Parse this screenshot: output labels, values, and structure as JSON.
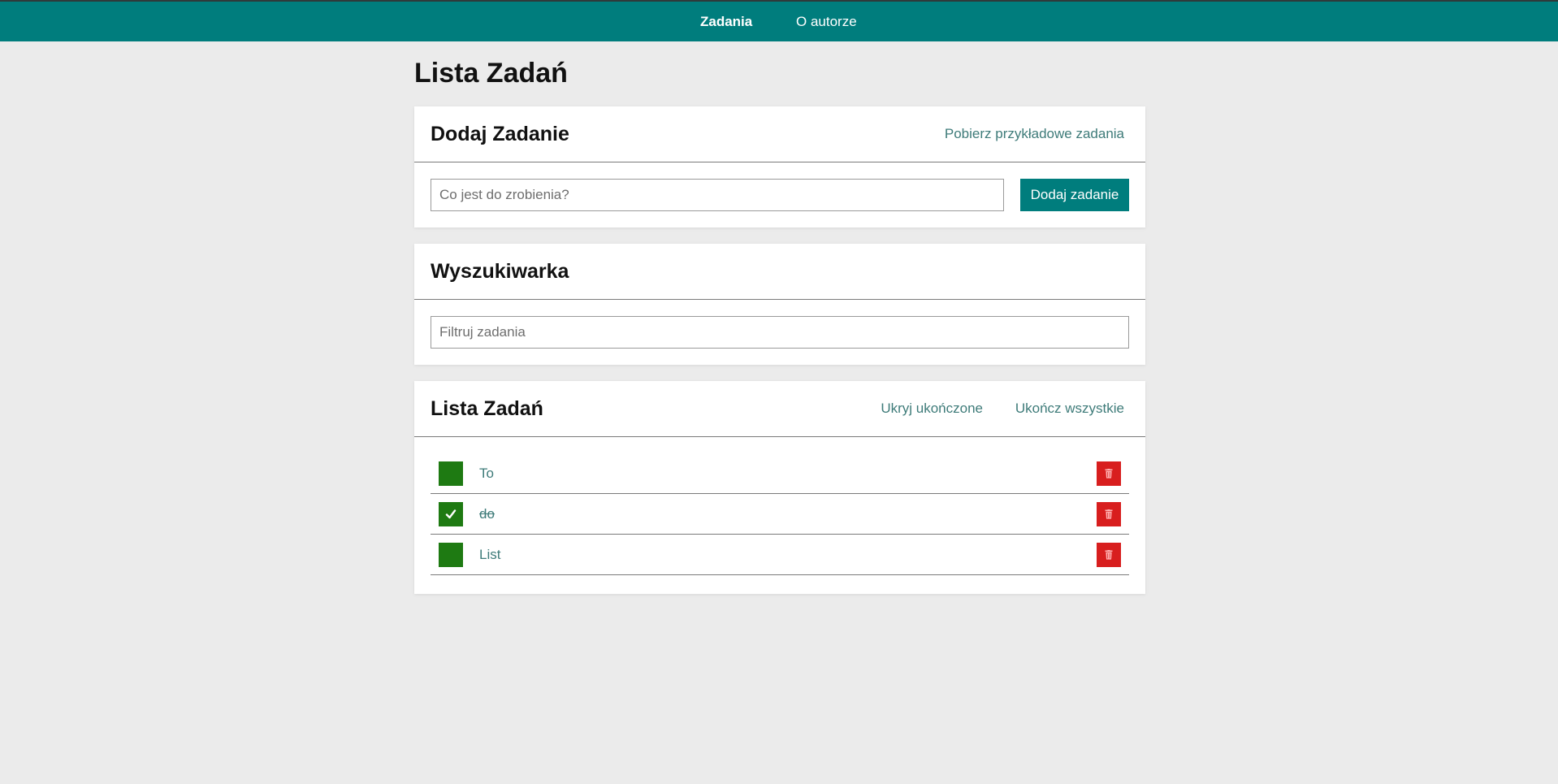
{
  "nav": {
    "items": [
      {
        "label": "Zadania",
        "active": true
      },
      {
        "label": "O autorze",
        "active": false
      }
    ]
  },
  "page": {
    "title": "Lista Zadań"
  },
  "add_card": {
    "title": "Dodaj Zadanie",
    "sample_link": "Pobierz przykładowe zadania",
    "input_placeholder": "Co jest do zrobienia?",
    "input_value": "",
    "button_label": "Dodaj zadanie"
  },
  "search_card": {
    "title": "Wyszukiwarka",
    "input_placeholder": "Filtruj zadania",
    "input_value": ""
  },
  "list_card": {
    "title": "Lista Zadań",
    "hide_completed_link": "Ukryj ukończone",
    "complete_all_link": "Ukończ wszystkie",
    "tasks": [
      {
        "label": "To",
        "done": false
      },
      {
        "label": "do",
        "done": true
      },
      {
        "label": "List",
        "done": false
      }
    ]
  },
  "colors": {
    "navbar": "#007d7d",
    "accent": "#007d7d",
    "checkbox": "#1e7a12",
    "delete": "#d81e1e",
    "link": "#3e7b79",
    "background": "#ebebeb"
  },
  "icons": {
    "check": "check-icon",
    "delete": "trash-icon"
  }
}
